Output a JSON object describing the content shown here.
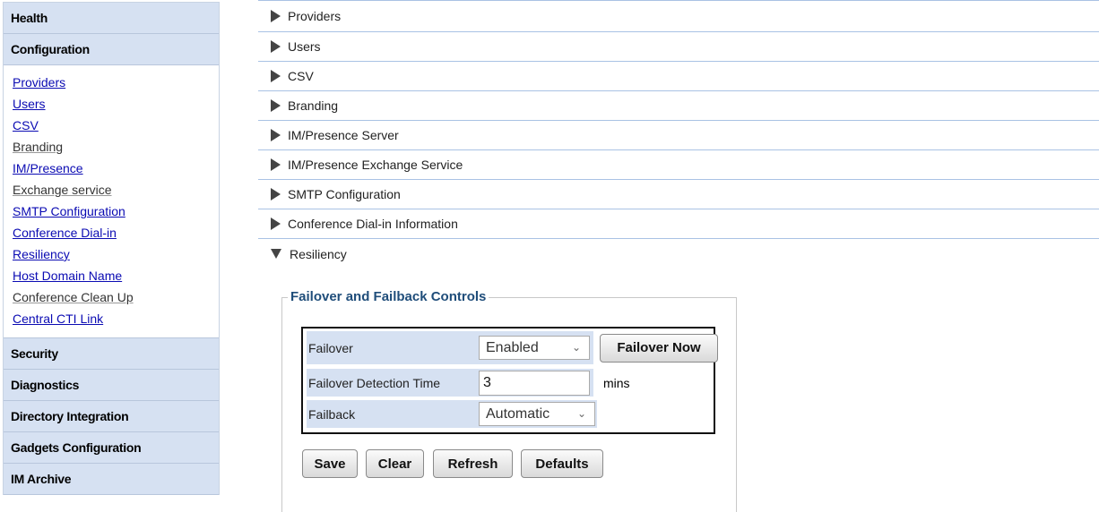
{
  "sidebar": {
    "health": "Health",
    "configuration": "Configuration",
    "config_links": [
      {
        "label": "Providers",
        "linked": true
      },
      {
        "label": "Users",
        "linked": true
      },
      {
        "label": "CSV",
        "linked": true
      },
      {
        "label": "Branding",
        "linked": false
      },
      {
        "label": "IM/Presence",
        "linked": true
      },
      {
        "label": "Exchange service",
        "linked": false
      },
      {
        "label": "SMTP Configuration",
        "linked": true
      },
      {
        "label": "Conference Dial-in",
        "linked": true
      },
      {
        "label": "Resiliency",
        "linked": true
      },
      {
        "label": "Host Domain Name",
        "linked": true
      },
      {
        "label": "Conference Clean Up",
        "linked": false
      },
      {
        "label": "Central CTI Link",
        "linked": true
      }
    ],
    "security": "Security",
    "diagnostics": "Diagnostics",
    "directory_integration": "Directory Integration",
    "gadgets_configuration": "Gadgets Configuration",
    "im_archive": "IM Archive"
  },
  "accordion": [
    {
      "label": "Providers",
      "open": false
    },
    {
      "label": "Users",
      "open": false
    },
    {
      "label": "CSV",
      "open": false
    },
    {
      "label": "Branding",
      "open": false
    },
    {
      "label": "IM/Presence Server",
      "open": false
    },
    {
      "label": "IM/Presence Exchange Service",
      "open": false
    },
    {
      "label": "SMTP Configuration",
      "open": false
    },
    {
      "label": "Conference Dial-in Information",
      "open": false
    },
    {
      "label": "Resiliency",
      "open": true
    }
  ],
  "resiliency": {
    "legend": "Failover and Failback Controls",
    "failover_label": "Failover",
    "failover_value": "Enabled",
    "failover_now_label": "Failover Now",
    "detection_label": "Failover Detection Time",
    "detection_value": "3",
    "detection_unit": "mins",
    "failback_label": "Failback",
    "failback_value": "Automatic",
    "buttons": {
      "save": "Save",
      "clear": "Clear",
      "refresh": "Refresh",
      "defaults": "Defaults"
    }
  },
  "icons": {
    "collapsed": "triangle-right-icon",
    "expanded": "triangle-down-icon",
    "select": "chevron-down-icon"
  }
}
